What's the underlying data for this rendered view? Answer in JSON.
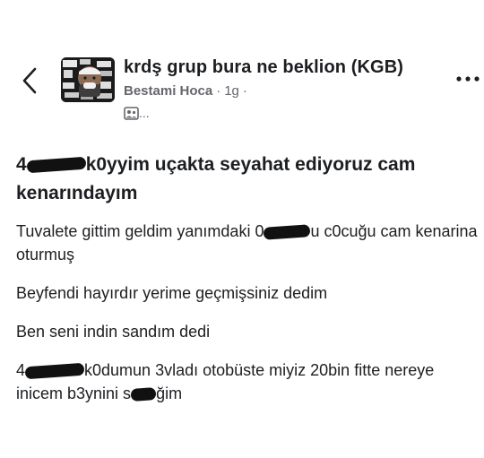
{
  "header": {
    "group_name": "krdş grup bura ne beklion (KGB)",
    "author": "Bestami Hoca",
    "separator": "·",
    "time": "1g",
    "dot": "·",
    "privacy_suffix": "..."
  },
  "icons": {
    "back": "chevron-left-icon",
    "more": "more-horizontal-icon",
    "audience": "group-audience-icon",
    "avatar": "group-avatar-image"
  },
  "post": {
    "heading": {
      "pre": "4",
      "post": "k0yyim uçakta seyahat ediyoruz cam kenarındayım"
    },
    "paragraphs": [
      {
        "pre": "Tuvalete gittim geldim yanımdaki 0",
        "post": "u c0cuğu cam kenarina oturmuş"
      },
      {
        "text": "Beyfendi hayırdır yerime geçmişsiniz dedim"
      },
      {
        "text": "Ben seni indin sandım dedi"
      },
      {
        "pre": "4",
        "mid": "k0dumun 3vladı otobüste miyiz 20bin fitte nereye inicem b3ynini s",
        "post": "ğim"
      }
    ]
  },
  "colors": {
    "text_primary": "#1c1e21",
    "text_secondary": "#65676b",
    "censor": "#111111"
  }
}
